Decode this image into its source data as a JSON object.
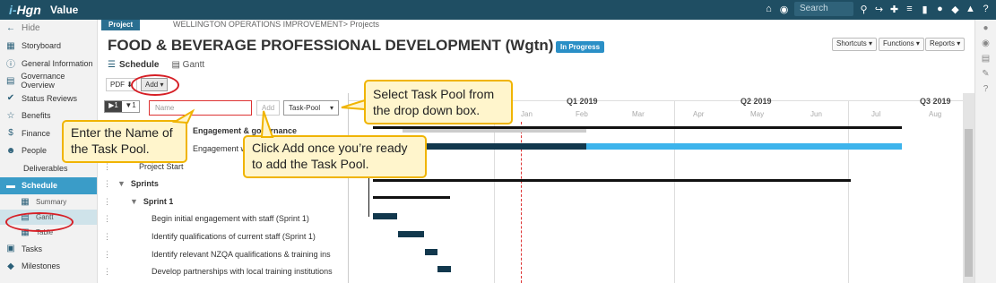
{
  "topbar": {
    "logo": "i-Hgn",
    "app_title": "Value",
    "search_placeholder": "Search"
  },
  "sidebar": {
    "hide": "Hide",
    "items": [
      {
        "label": "Storyboard",
        "icon": "storyboard-icon"
      },
      {
        "label": "General Information",
        "icon": "info-icon"
      },
      {
        "label": "Governance Overview",
        "icon": "governance-icon"
      },
      {
        "label": "Status Reviews",
        "icon": "check-icon"
      },
      {
        "label": "Benefits",
        "icon": "star-icon"
      },
      {
        "label": "Finance",
        "icon": "dollar-icon"
      },
      {
        "label": "People",
        "icon": "people-icon"
      },
      {
        "label": "Deliverables",
        "icon": ""
      },
      {
        "label": "Schedule",
        "icon": "schedule-icon"
      },
      {
        "label": "Summary",
        "icon": "summary-icon"
      },
      {
        "label": "Gantt",
        "icon": "gantt-icon"
      },
      {
        "label": "Table",
        "icon": "table-icon"
      },
      {
        "label": "Tasks",
        "icon": "tasks-icon"
      },
      {
        "label": "Milestones",
        "icon": "milestone-icon"
      }
    ]
  },
  "header": {
    "project_badge": "Project",
    "breadcrumb": "WELLINGTON OPERATIONS IMPROVEMENT> Projects",
    "title": "FOOD & BEVERAGE PROFESSIONAL DEVELOPMENT (Wgtn)",
    "status": "In Progress",
    "shortcuts": "Shortcuts ▾",
    "functions": "Functions ▾",
    "reports": "Reports ▾",
    "schedule_label": "Schedule",
    "gantt_label": "Gantt",
    "pdf": "PDF",
    "add": "Add ▾"
  },
  "form": {
    "name_placeholder": "Name",
    "add_label": "Add",
    "type_value": "Task-Pool",
    "toggle_a": "▶1",
    "toggle_b": "▼1"
  },
  "rows": [
    {
      "label": "Engagement & governance"
    },
    {
      "label": "Engagement work"
    },
    {
      "label": "Project Start"
    },
    {
      "label": "Sprints"
    },
    {
      "label": "Sprint 1"
    },
    {
      "label": "Begin initial engagement with staff (Sprint 1)"
    },
    {
      "label": "Identify qualifications of current staff (Sprint 1)"
    },
    {
      "label": "Identify relevant NZQA qualifications & training ins"
    },
    {
      "label": "Develop partnerships with local training institutions"
    }
  ],
  "timeline": {
    "quarters": [
      "Q1 2019",
      "Q2 2019",
      "Q3 2019"
    ],
    "months": [
      "Jan",
      "Feb",
      "Mar",
      "Apr",
      "May",
      "Jun",
      "Jul",
      "Aug"
    ]
  },
  "callouts": {
    "name": "Enter the Name of the Task Pool.",
    "select": "Select Task Pool from the drop down box.",
    "add": "Click Add once you’re ready to add the Task Pool."
  },
  "colors": {
    "topbar": "#1f4e63",
    "accent": "#3a9cc8",
    "highlight": "#d61f26",
    "callout": "#fff5cc",
    "bar_dark": "#12384d",
    "bar_light": "#3db4ec"
  }
}
